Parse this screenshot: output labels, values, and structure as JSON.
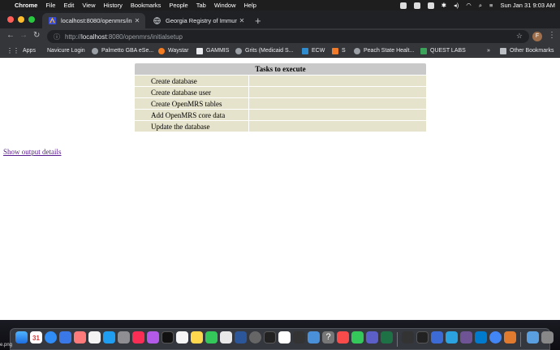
{
  "menubar": {
    "app": "Chrome",
    "items": [
      "File",
      "Edit",
      "View",
      "History",
      "Bookmarks",
      "People",
      "Tab",
      "Window",
      "Help"
    ],
    "clock": "Sun Jan 31  9:03 AM"
  },
  "tabs": [
    {
      "title": "localhost:8080/openmrs/initialse",
      "active": true
    },
    {
      "title": "Georgia Registry of Immunizatio",
      "active": false
    }
  ],
  "address": {
    "scheme": "http://",
    "host": "localhost",
    "path": ":8080/openmrs/initialsetup"
  },
  "profile_initial": "F",
  "bookmarks": {
    "items": [
      "Apps",
      "Navicure Login",
      "Palmetto GBA eSe...",
      "Waystar",
      "GAMMIS",
      "Grits (Medicaid S...",
      "ECW",
      "S",
      "Peach State Healt...",
      "QUEST LABS"
    ],
    "overflow": "»",
    "other": "Other Bookmarks"
  },
  "page": {
    "table_header": "Tasks to execute",
    "tasks": [
      "Create database",
      "Create database user",
      "Create OpenMRS tables",
      "Add OpenMRS core data",
      "Update the database"
    ],
    "output_link": "Show output details"
  },
  "dock": {
    "calendar_day": "31",
    "desktop_label": "e.png"
  }
}
